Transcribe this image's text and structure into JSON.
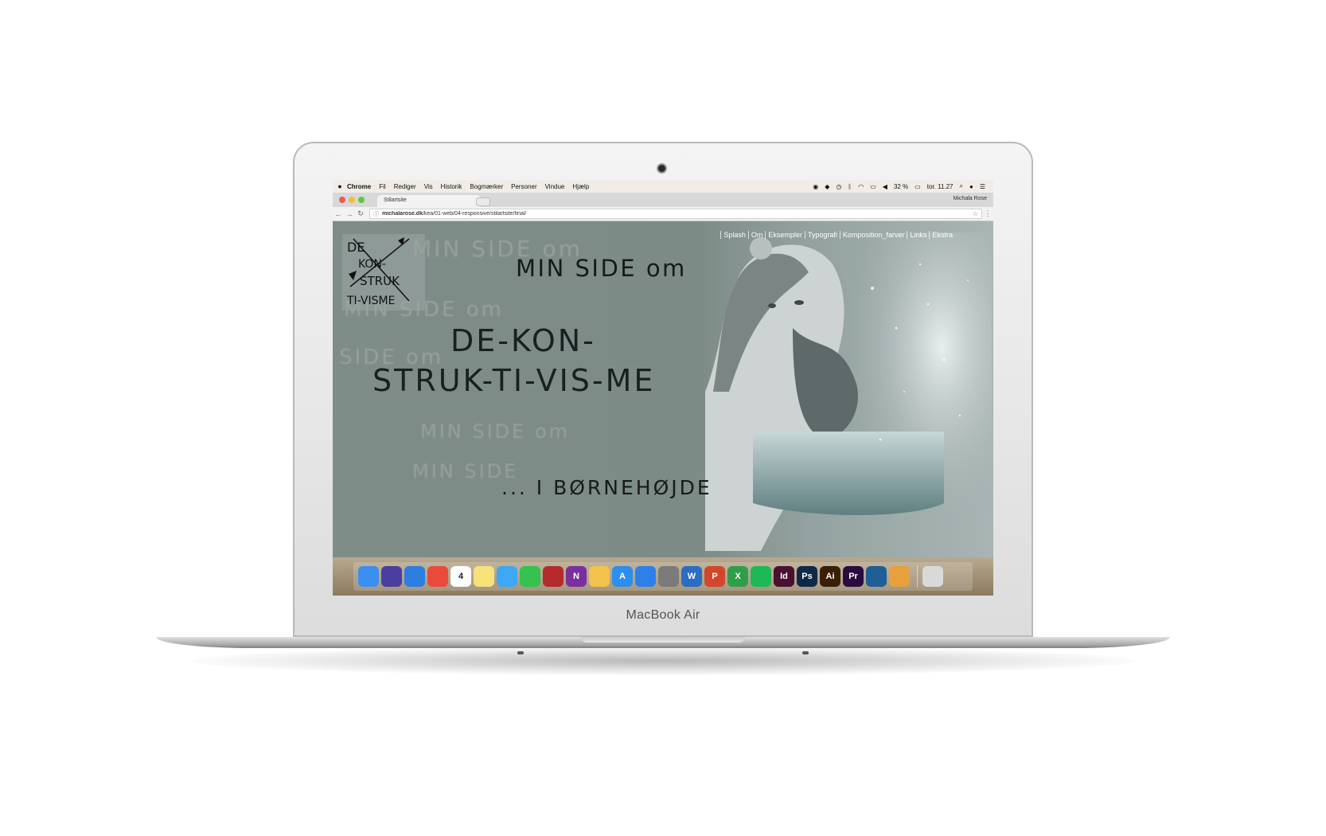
{
  "device": {
    "label": "MacBook Air"
  },
  "menubar": {
    "app": "Chrome",
    "items": [
      "Fil",
      "Rediger",
      "Vis",
      "Historik",
      "Bogmærker",
      "Personer",
      "Vindue",
      "Hjælp"
    ],
    "battery": "32 %",
    "clock": "tor. 11.27"
  },
  "browser": {
    "tab_title": "Stilartsite",
    "profile": "Michala Rose",
    "url_host": "michalarose.dk",
    "url_path": "/kea/01-web/04-responsive/stilartsite/final/"
  },
  "site": {
    "nav": [
      "Splash",
      "Om",
      "Eksempler",
      "Typografi",
      "Komposition_farver",
      "Links",
      "Ekstra"
    ],
    "heading_top": "MIN SIDE om",
    "heading_line1": "DE-KON-",
    "heading_line2": "STRUK-TI-VIS-ME",
    "heading_bottom": "... I BØRNEHØJDE",
    "logo_lines": [
      "DE",
      "KON-",
      "STRUK",
      "TI-VISME"
    ],
    "ghost_text": [
      "MIN SIDE om",
      "MIN SIDE om",
      "SIDE om",
      "MIN SIDE om",
      "MIN SIDE"
    ]
  },
  "dock": {
    "apps": [
      {
        "name": "finder",
        "label": "",
        "color": "#3b8ff0"
      },
      {
        "name": "siri",
        "label": "",
        "color": "#4a3f9e"
      },
      {
        "name": "safari",
        "label": "",
        "color": "#2c7ee0"
      },
      {
        "name": "chrome",
        "label": "",
        "color": "#e84b3c"
      },
      {
        "name": "calendar",
        "label": "4",
        "color": "#fdfdfd"
      },
      {
        "name": "notes",
        "label": "",
        "color": "#f7e27a"
      },
      {
        "name": "messages",
        "label": "",
        "color": "#3da8f3"
      },
      {
        "name": "facetime",
        "label": "",
        "color": "#36c24f"
      },
      {
        "name": "photo-booth",
        "label": "",
        "color": "#b52b2b"
      },
      {
        "name": "onenote",
        "label": "N",
        "color": "#7b2f9e"
      },
      {
        "name": "photos",
        "label": "",
        "color": "#f3c24a"
      },
      {
        "name": "app-store",
        "label": "A",
        "color": "#2b8ef0"
      },
      {
        "name": "dropbox",
        "label": "",
        "color": "#2f7fe8"
      },
      {
        "name": "system-preferences",
        "label": "",
        "color": "#7b7b7b"
      },
      {
        "name": "word",
        "label": "W",
        "color": "#2b6cc4"
      },
      {
        "name": "powerpoint",
        "label": "P",
        "color": "#d2472b"
      },
      {
        "name": "excel",
        "label": "X",
        "color": "#2f9e4a"
      },
      {
        "name": "spotify",
        "label": "",
        "color": "#1db954"
      },
      {
        "name": "indesign",
        "label": "Id",
        "color": "#4a1030"
      },
      {
        "name": "photoshop",
        "label": "Ps",
        "color": "#0f2a48"
      },
      {
        "name": "illustrator",
        "label": "Ai",
        "color": "#3a1e06"
      },
      {
        "name": "premiere",
        "label": "Pr",
        "color": "#2a0b3f"
      },
      {
        "name": "brackets",
        "label": "",
        "color": "#1f5f96"
      },
      {
        "name": "chrome-canary",
        "label": "",
        "color": "#e8a03c"
      }
    ],
    "trash": {
      "name": "trash",
      "label": "",
      "color": "#d9d9d9"
    }
  }
}
